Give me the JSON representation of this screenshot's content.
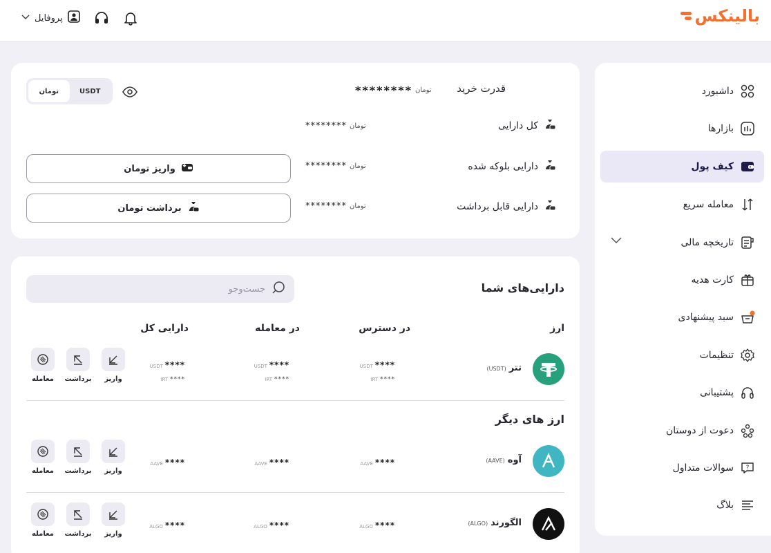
{
  "brand": {
    "name": "بالینکس",
    "color": "#f26f2d"
  },
  "header": {
    "profile_label": "پروفایل",
    "icons": [
      "bell-icon",
      "headset-icon",
      "user-icon",
      "chevron-down-icon"
    ]
  },
  "sidebar": {
    "items": [
      {
        "label": "داشبورد",
        "icon": "dashboard-icon"
      },
      {
        "label": "بازارها",
        "icon": "markets-icon"
      },
      {
        "label": "کیف پول",
        "icon": "wallet-icon",
        "active": true
      },
      {
        "label": "معامله سریع",
        "icon": "swap-arrows-icon"
      },
      {
        "label": "تاریخچه مالی",
        "icon": "history-icon",
        "expandable": true
      },
      {
        "label": "کارت هدیه",
        "icon": "gift-card-icon"
      },
      {
        "label": "سبد پیشنهادی",
        "icon": "basket-icon",
        "badge": true
      },
      {
        "label": "تنظیمات",
        "icon": "settings-icon"
      },
      {
        "label": "پشتیبانی",
        "icon": "support-icon"
      },
      {
        "label": "دعوت از دوستان",
        "icon": "invite-friends-icon"
      },
      {
        "label": "سوالات متداول",
        "icon": "faq-icon"
      },
      {
        "label": "بلاگ",
        "icon": "blog-icon"
      }
    ]
  },
  "balance": {
    "buying_power_label": "قدرت خرید",
    "buying_power_value": "********",
    "toman_mark": "تومان",
    "total_label": "کل دارایی",
    "total_value": "********",
    "blocked_label": "دارایی بلوکه شده",
    "blocked_value": "********",
    "withdrawable_label": "دارایی قابل برداشت",
    "withdrawable_value": "********",
    "currency_toggle": {
      "options": [
        "تومان",
        "USDT"
      ],
      "selected": "تومان"
    },
    "deposit_button": "واریز تومان",
    "withdraw_button": "برداشت تومان"
  },
  "assets": {
    "title": "دارایی‌های شما",
    "search_placeholder": "جست‌وجو",
    "columns": {
      "currency": "ارز",
      "available": "در دسترس",
      "in_trade": "در معامله",
      "total": "دارایی کل"
    },
    "actions": {
      "deposit": "واریز",
      "withdraw": "برداشت",
      "trade": "معامله"
    },
    "your_coins": [
      {
        "name": "تتر",
        "symbol": "(USDT)",
        "logo_color": "#26a17b",
        "logo_glyph": "T",
        "available": {
          "value": "****",
          "unit": "USDT",
          "value2": "****",
          "unit2": "IRT"
        },
        "in_trade": {
          "value": "****",
          "unit": "USDT",
          "value2": "****",
          "unit2": "IRT"
        },
        "total": {
          "value": "****",
          "unit": "USDT",
          "value2": "****",
          "unit2": "IRT"
        }
      }
    ],
    "other_title": "ارز های دیگر",
    "other_coins": [
      {
        "name": "آوه",
        "symbol": "(AAVE)",
        "logo_color": "#3fb6c2",
        "logo_glyph": "Λ",
        "available": {
          "value": "****",
          "unit": "AAVE"
        },
        "in_trade": {
          "value": "****",
          "unit": "AAVE"
        },
        "total": {
          "value": "****",
          "unit": "AAVE"
        }
      },
      {
        "name": "الگورند",
        "symbol": "(ALGO)",
        "logo_color": "#111111",
        "logo_glyph": "A",
        "available": {
          "value": "****",
          "unit": "ALGO"
        },
        "in_trade": {
          "value": "****",
          "unit": "ALGO"
        },
        "total": {
          "value": "****",
          "unit": "ALGO"
        }
      }
    ]
  },
  "colors": {
    "accent": "#1c1b4a",
    "active_bg": "#eae8f7",
    "page_bg": "#f1f0f6"
  }
}
